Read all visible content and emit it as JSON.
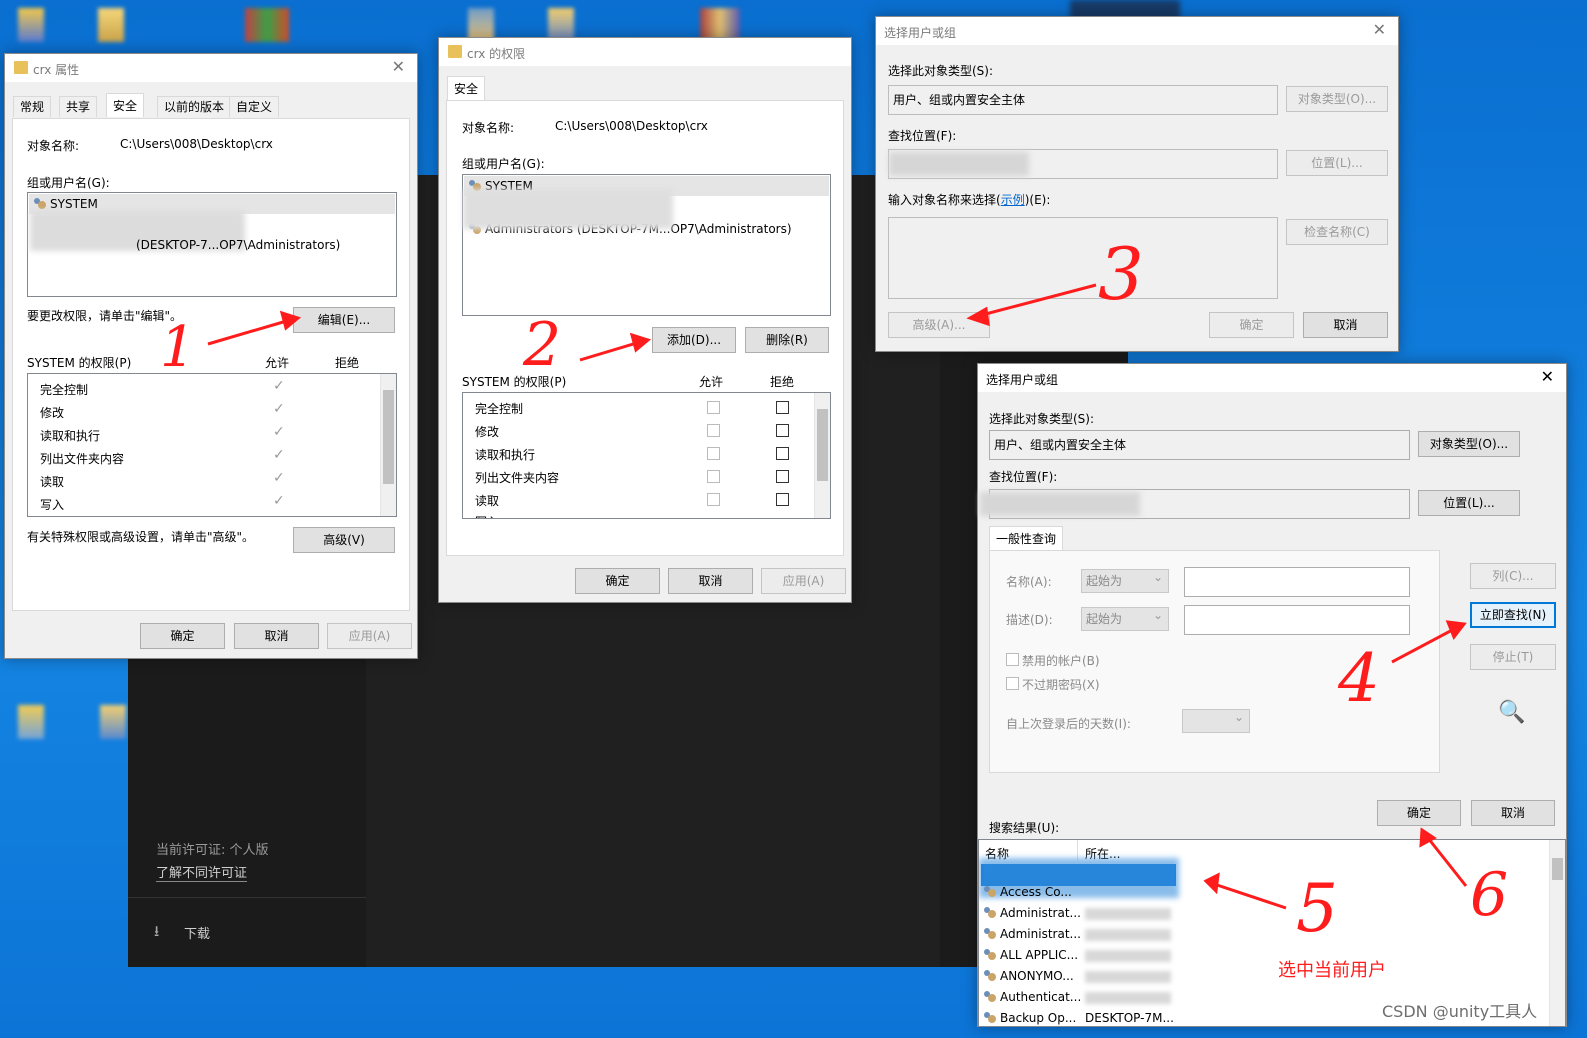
{
  "colors": {
    "desktop": "#1078d4",
    "accent": "#0078d7",
    "annotation": "#ff1c1c",
    "select_highlight": "#0c77d9"
  },
  "darkapp": {
    "license_text": "当前许可证: 个人版",
    "license_link": "了解不同许可证",
    "download": "下载",
    "download_icon": "download-icon"
  },
  "props": {
    "title": "crx 属性",
    "close": "✕",
    "tabs": [
      "常规",
      "共享",
      "安全",
      "以前的版本",
      "自定义"
    ],
    "object_label": "对象名称:",
    "object_value": "C:\\Users\\008\\Desktop\\crx",
    "group_label": "组或用户名(G):",
    "users": [
      "SYSTEM",
      "...\\Administrators",
      "",
      ""
    ],
    "users_partial": "(DESKTOP-7...OP7\\Administrators)",
    "change_hint": "要更改权限，请单击\"编辑\"。",
    "edit_button": "编辑(E)...",
    "perm_header": "SYSTEM 的权限(P)",
    "allow": "允许",
    "deny": "拒绝",
    "perms": [
      "完全控制",
      "修改",
      "读取和执行",
      "列出文件夹内容",
      "读取",
      "写入"
    ],
    "advanced_hint": "有关特殊权限或高级设置，请单击\"高级\"。",
    "advanced_button": "高级(V)",
    "ok": "确定",
    "cancel": "取消",
    "apply": "应用(A)"
  },
  "perm": {
    "title": "crx 的权限",
    "tab": "安全",
    "object_label": "对象名称:",
    "object_value": "C:\\Users\\008\\Desktop\\crx",
    "group_label": "组或用户名(G):",
    "users": [
      "SYSTEM",
      "Administrators (DESKTOP-7M...OP7\\Administrators)"
    ],
    "add_button": "添加(D)...",
    "remove_button": "删除(R)",
    "perm_header": "SYSTEM 的权限(P)",
    "allow": "允许",
    "deny": "拒绝",
    "perms": [
      "完全控制",
      "修改",
      "读取和执行",
      "列出文件夹内容",
      "读取",
      "写入"
    ],
    "ok": "确定",
    "cancel": "取消",
    "apply": "应用(A)"
  },
  "select1": {
    "title": "选择用户或组",
    "type_label": "选择此对象类型(S):",
    "type_value": "用户、组或内置安全主体",
    "type_button": "对象类型(O)...",
    "location_label": "查找位置(F):",
    "location_button": "位置(L)...",
    "enter_label": "输入对象名称来选择(",
    "enter_link": "示例",
    "enter_label_end": ")(E):",
    "check_button": "检查名称(C)",
    "advanced_button": "高级(A)...",
    "ok": "确定",
    "cancel": "取消"
  },
  "select2": {
    "title": "选择用户或组",
    "type_label": "选择此对象类型(S):",
    "type_value": "用户、组或内置安全主体",
    "type_button": "对象类型(O)...",
    "location_label": "查找位置(F):",
    "location_button": "位置(L)...",
    "query_tab": "一般性查询",
    "name_label": "名称(A):",
    "desc_label": "描述(D):",
    "starts_with": "起始为",
    "disabled_accounts": "禁用的帐户(B)",
    "non_expiring": "不过期密码(X)",
    "days_label": "自上次登录后的天数(I):",
    "columns_button": "列(C)...",
    "find_now_button": "立即查找(N)",
    "stop_button": "停止(T)",
    "ok": "确定",
    "cancel": "取消",
    "results_label": "搜索结果(U):",
    "col_name": "名称",
    "col_folder": "所在...",
    "results": [
      {
        "name": "",
        "folder": ""
      },
      {
        "name": "Access Co...",
        "folder": ""
      },
      {
        "name": "Administrat...",
        "folder": ""
      },
      {
        "name": "Administrat...",
        "folder": ""
      },
      {
        "name": "ALL APPLIC...",
        "folder": ""
      },
      {
        "name": "ANONYMO...",
        "folder": ""
      },
      {
        "name": "Authenticat...",
        "folder": ""
      },
      {
        "name": "Backup Op...",
        "folder": "DESKTOP-7M..."
      }
    ]
  },
  "annotations": {
    "a1": "1",
    "a2": "2",
    "a3": "3",
    "a4": "4",
    "a5": "5",
    "a6": "6",
    "select_current_user": "选中当前用户"
  },
  "watermark": "CSDN @unity工具人"
}
